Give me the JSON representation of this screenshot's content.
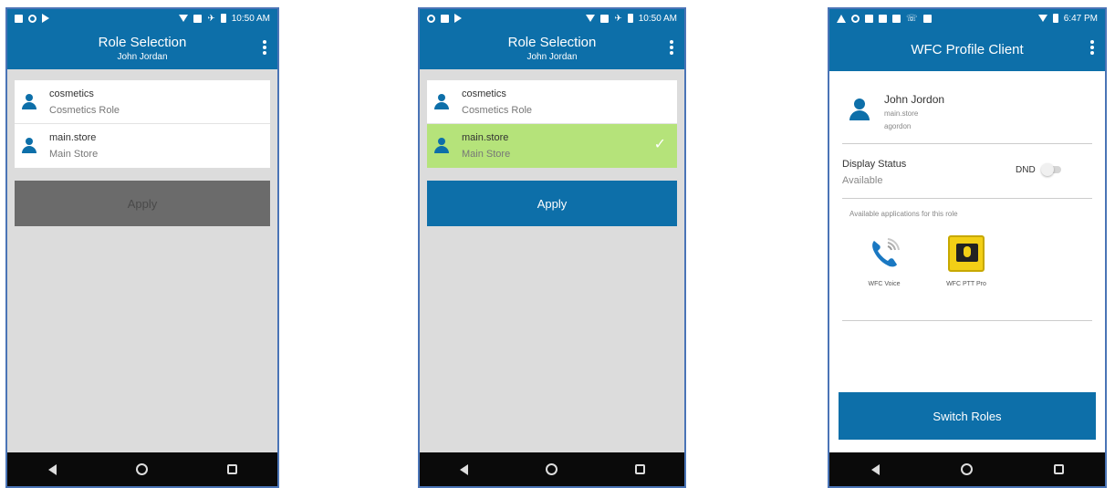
{
  "colors": {
    "primary": "#0d6fa9",
    "selected_row": "#b5e37a",
    "disabled_button": "#6b6b6b",
    "nav_bar": "#0a0a0a"
  },
  "screen1": {
    "status_time": "10:50 AM",
    "title": "Role Selection",
    "subtitle": "John Jordan",
    "roles": [
      {
        "name": "cosmetics",
        "desc": "Cosmetics Role"
      },
      {
        "name": "main.store",
        "desc": "Main Store"
      }
    ],
    "apply_label": "Apply"
  },
  "screen2": {
    "status_time": "10:50 AM",
    "title": "Role Selection",
    "subtitle": "John Jordan",
    "roles": [
      {
        "name": "cosmetics",
        "desc": "Cosmetics Role"
      },
      {
        "name": "main.store",
        "desc": "Main Store"
      }
    ],
    "selected_check": "✓",
    "apply_label": "Apply"
  },
  "screen3": {
    "status_time": "6:47 PM",
    "title": "WFC Profile Client",
    "profile": {
      "name": "John Jordon",
      "store": "main.store",
      "user": "agordon"
    },
    "display_status": {
      "label": "Display Status",
      "value": "Available",
      "dnd_label": "DND",
      "dnd_on": false
    },
    "apps_caption": "Available applications for this role",
    "apps": [
      {
        "label": "WFC Voice",
        "icon": "phone-icon"
      },
      {
        "label": "WFC PTT Pro",
        "icon": "ptt-icon"
      }
    ],
    "switch_label": "Switch Roles"
  }
}
